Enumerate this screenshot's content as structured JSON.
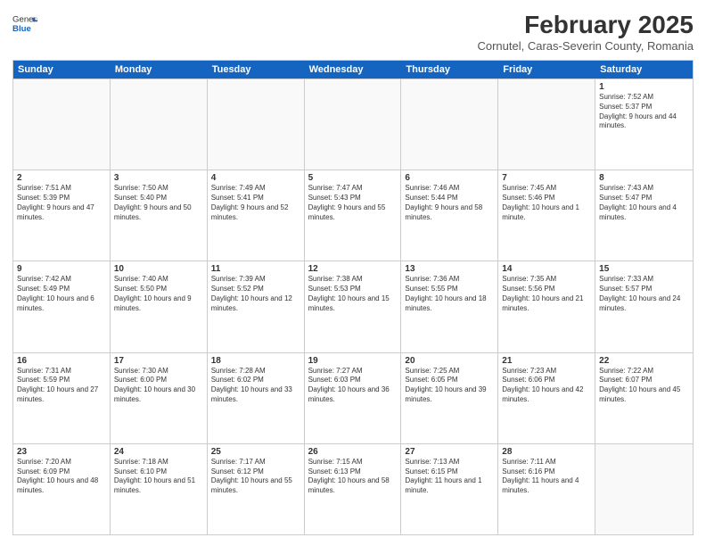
{
  "header": {
    "logo_general": "General",
    "logo_blue": "Blue",
    "month_title": "February 2025",
    "location": "Cornutel, Caras-Severin County, Romania"
  },
  "weekdays": [
    "Sunday",
    "Monday",
    "Tuesday",
    "Wednesday",
    "Thursday",
    "Friday",
    "Saturday"
  ],
  "weeks": [
    [
      {
        "day": "",
        "info": ""
      },
      {
        "day": "",
        "info": ""
      },
      {
        "day": "",
        "info": ""
      },
      {
        "day": "",
        "info": ""
      },
      {
        "day": "",
        "info": ""
      },
      {
        "day": "",
        "info": ""
      },
      {
        "day": "1",
        "info": "Sunrise: 7:52 AM\nSunset: 5:37 PM\nDaylight: 9 hours and 44 minutes."
      }
    ],
    [
      {
        "day": "2",
        "info": "Sunrise: 7:51 AM\nSunset: 5:39 PM\nDaylight: 9 hours and 47 minutes."
      },
      {
        "day": "3",
        "info": "Sunrise: 7:50 AM\nSunset: 5:40 PM\nDaylight: 9 hours and 50 minutes."
      },
      {
        "day": "4",
        "info": "Sunrise: 7:49 AM\nSunset: 5:41 PM\nDaylight: 9 hours and 52 minutes."
      },
      {
        "day": "5",
        "info": "Sunrise: 7:47 AM\nSunset: 5:43 PM\nDaylight: 9 hours and 55 minutes."
      },
      {
        "day": "6",
        "info": "Sunrise: 7:46 AM\nSunset: 5:44 PM\nDaylight: 9 hours and 58 minutes."
      },
      {
        "day": "7",
        "info": "Sunrise: 7:45 AM\nSunset: 5:46 PM\nDaylight: 10 hours and 1 minute."
      },
      {
        "day": "8",
        "info": "Sunrise: 7:43 AM\nSunset: 5:47 PM\nDaylight: 10 hours and 4 minutes."
      }
    ],
    [
      {
        "day": "9",
        "info": "Sunrise: 7:42 AM\nSunset: 5:49 PM\nDaylight: 10 hours and 6 minutes."
      },
      {
        "day": "10",
        "info": "Sunrise: 7:40 AM\nSunset: 5:50 PM\nDaylight: 10 hours and 9 minutes."
      },
      {
        "day": "11",
        "info": "Sunrise: 7:39 AM\nSunset: 5:52 PM\nDaylight: 10 hours and 12 minutes."
      },
      {
        "day": "12",
        "info": "Sunrise: 7:38 AM\nSunset: 5:53 PM\nDaylight: 10 hours and 15 minutes."
      },
      {
        "day": "13",
        "info": "Sunrise: 7:36 AM\nSunset: 5:55 PM\nDaylight: 10 hours and 18 minutes."
      },
      {
        "day": "14",
        "info": "Sunrise: 7:35 AM\nSunset: 5:56 PM\nDaylight: 10 hours and 21 minutes."
      },
      {
        "day": "15",
        "info": "Sunrise: 7:33 AM\nSunset: 5:57 PM\nDaylight: 10 hours and 24 minutes."
      }
    ],
    [
      {
        "day": "16",
        "info": "Sunrise: 7:31 AM\nSunset: 5:59 PM\nDaylight: 10 hours and 27 minutes."
      },
      {
        "day": "17",
        "info": "Sunrise: 7:30 AM\nSunset: 6:00 PM\nDaylight: 10 hours and 30 minutes."
      },
      {
        "day": "18",
        "info": "Sunrise: 7:28 AM\nSunset: 6:02 PM\nDaylight: 10 hours and 33 minutes."
      },
      {
        "day": "19",
        "info": "Sunrise: 7:27 AM\nSunset: 6:03 PM\nDaylight: 10 hours and 36 minutes."
      },
      {
        "day": "20",
        "info": "Sunrise: 7:25 AM\nSunset: 6:05 PM\nDaylight: 10 hours and 39 minutes."
      },
      {
        "day": "21",
        "info": "Sunrise: 7:23 AM\nSunset: 6:06 PM\nDaylight: 10 hours and 42 minutes."
      },
      {
        "day": "22",
        "info": "Sunrise: 7:22 AM\nSunset: 6:07 PM\nDaylight: 10 hours and 45 minutes."
      }
    ],
    [
      {
        "day": "23",
        "info": "Sunrise: 7:20 AM\nSunset: 6:09 PM\nDaylight: 10 hours and 48 minutes."
      },
      {
        "day": "24",
        "info": "Sunrise: 7:18 AM\nSunset: 6:10 PM\nDaylight: 10 hours and 51 minutes."
      },
      {
        "day": "25",
        "info": "Sunrise: 7:17 AM\nSunset: 6:12 PM\nDaylight: 10 hours and 55 minutes."
      },
      {
        "day": "26",
        "info": "Sunrise: 7:15 AM\nSunset: 6:13 PM\nDaylight: 10 hours and 58 minutes."
      },
      {
        "day": "27",
        "info": "Sunrise: 7:13 AM\nSunset: 6:15 PM\nDaylight: 11 hours and 1 minute."
      },
      {
        "day": "28",
        "info": "Sunrise: 7:11 AM\nSunset: 6:16 PM\nDaylight: 11 hours and 4 minutes."
      },
      {
        "day": "",
        "info": ""
      }
    ]
  ]
}
